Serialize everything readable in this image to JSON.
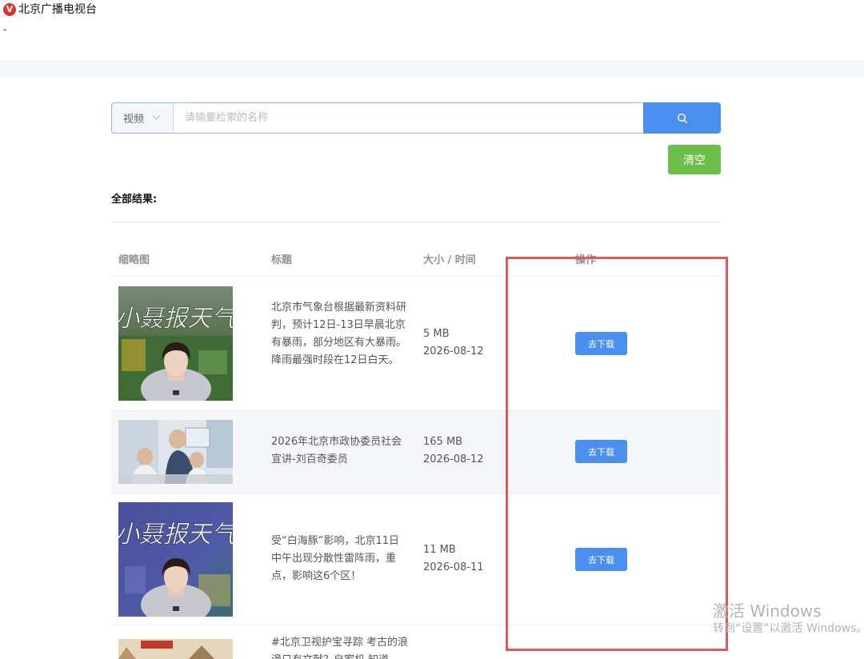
{
  "header": {
    "logo_glyph": "V",
    "site_name": "北京广播电视台",
    "dash": "-"
  },
  "search": {
    "type_selected": "视频",
    "placeholder": "请输要检索的名称",
    "value": ""
  },
  "actions": {
    "clear_label": "清空"
  },
  "results": {
    "label": "全部结果:",
    "columns": [
      "缩略图",
      "标题",
      "大小 / 时间",
      "操作"
    ],
    "rows": [
      {
        "title": "北京市气象台根据最新资料研判，预计12日-13日早晨北京有暴雨，部分地区有大暴雨。降雨最强时段在12日白天。",
        "size": "5 MB",
        "date": "2026-08-12",
        "action": "去下载",
        "thumb_caption": "小聂报天气"
      },
      {
        "title": "2026年北京市政协委员社会宣讲-刘百奇委员",
        "size": "165 MB",
        "date": "2026-08-12",
        "action": "去下载"
      },
      {
        "title": "受“白海豚”影响，北京11日中午出现分散性雷阵雨，重点，影响这6个区！",
        "size": "11 MB",
        "date": "2026-08-11",
        "action": "去下载",
        "thumb_caption": "小聂报天气"
      },
      {
        "title": "#北京卫视护宝寻踪 考古的浪漫只有文献？自家机 知道"
      }
    ]
  },
  "watermark": {
    "line1": "激活 Windows",
    "line2": "转到“设置”以激活 Windows。"
  },
  "colors": {
    "primary": "#4a8ff0",
    "success": "#6cc04a",
    "highlight": "#e05a5a"
  }
}
